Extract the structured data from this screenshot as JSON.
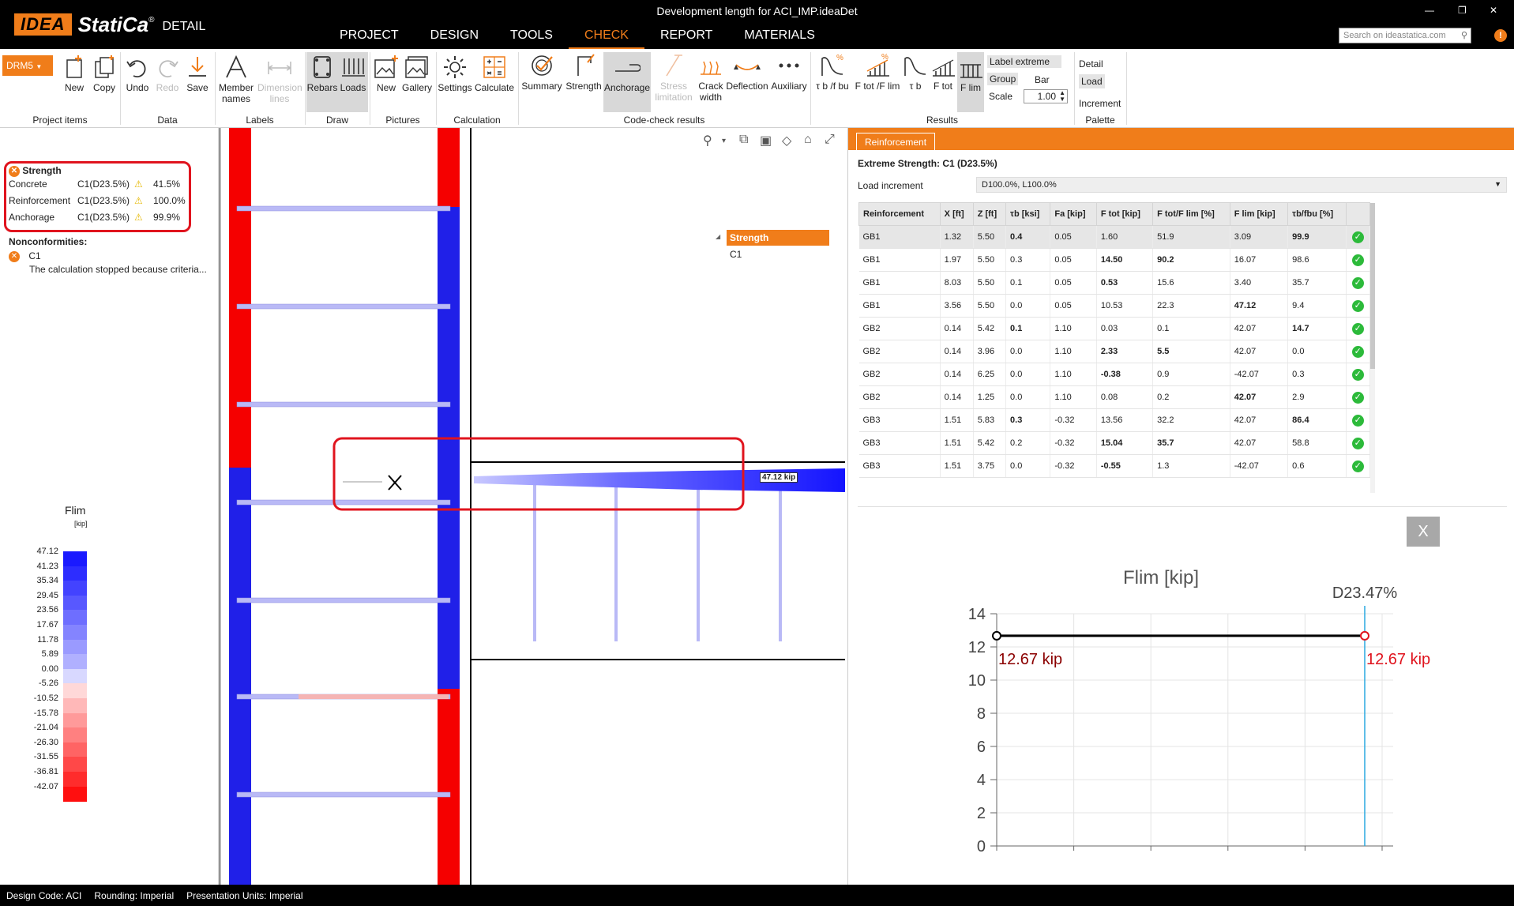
{
  "app": {
    "logo_box": "IDEA",
    "logo_name": "StatiCa",
    "logo_reg": "®",
    "product": "DETAIL",
    "window_title": "Development length for ACI_IMP.ideaDet",
    "minimize": "—",
    "maximize": "❐",
    "close": "✕"
  },
  "menu": {
    "tabs": [
      {
        "label": "PROJECT"
      },
      {
        "label": "DESIGN"
      },
      {
        "label": "TOOLS"
      },
      {
        "label": "CHECK"
      },
      {
        "label": "REPORT"
      },
      {
        "label": "MATERIALS"
      }
    ],
    "active": "CHECK",
    "search_placeholder": "Search on ideastatica.com"
  },
  "ribbon": {
    "model": "DRM5",
    "buttons": {
      "new": "New",
      "copy": "Copy",
      "undo": "Undo",
      "redo": "Redo",
      "save": "Save",
      "member_names_1": "Member",
      "member_names_2": "names",
      "dimension_lines_1": "Dimension",
      "dimension_lines_2": "lines",
      "rebars": "Rebars",
      "loads": "Loads",
      "new_picture": "New",
      "gallery": "Gallery",
      "settings": "Settings",
      "calculate": "Calculate",
      "summary": "Summary",
      "strength": "Strength",
      "anchorage": "Anchorage",
      "stress_limitation_1": "Stress",
      "stress_limitation_2": "limitation",
      "crack_width_1": "Crack",
      "crack_width_2": "width",
      "deflection": "Deflection",
      "auxiliary": "Auxiliary",
      "res_tb_fbu": "τ b /f bu",
      "res_ftot_flim": "F tot /F lim",
      "res_tb": "τ b",
      "res_ftot": "F tot",
      "res_flim": "F lim"
    },
    "groups": [
      "Project items",
      "Data",
      "Labels",
      "Draw",
      "Pictures",
      "Calculation",
      "Code-check results",
      "Results",
      "Palette"
    ],
    "options": {
      "label_extreme": "Label extreme",
      "group": "Group",
      "bar": "Bar",
      "scale_label": "Scale",
      "scale_value": "1.00",
      "detail": "Detail",
      "load": "Load",
      "increment": "Increment"
    }
  },
  "left": {
    "strength_title": "Strength",
    "checks": [
      {
        "name": "Concrete",
        "case": "C1(D23.5%)",
        "value": "41.5%"
      },
      {
        "name": "Reinforcement",
        "case": "C1(D23.5%)",
        "value": "100.0%"
      },
      {
        "name": "Anchorage",
        "case": "C1(D23.5%)",
        "value": "99.9%"
      }
    ],
    "nonconformities_title": "Nonconformities:",
    "nonconformity_item": "C1",
    "nonconformity_text": "The calculation stopped because criteria...",
    "legend_title": "Flim",
    "legend_unit": "[kip]",
    "legend_values": [
      "47.12",
      "41.23",
      "35.34",
      "29.45",
      "23.56",
      "17.67",
      "11.78",
      "5.89",
      "0.00",
      "-5.26",
      "-10.52",
      "-15.78",
      "-21.04",
      "-26.30",
      "-31.55",
      "-36.81",
      "-42.07"
    ],
    "legend_colors": [
      "#1a1aff",
      "#2d2dff",
      "#4343ff",
      "#5858ff",
      "#6e6eff",
      "#8484ff",
      "#9a9aff",
      "#b0b0ff",
      "#d8d8ff",
      "#ffd8d8",
      "#ffb8b8",
      "#ff9a9a",
      "#ff8080",
      "#ff6464",
      "#ff4848",
      "#ff2c2c",
      "#ff0f0f"
    ]
  },
  "viewport": {
    "tree_header": "Strength",
    "tree_item": "C1",
    "label_value": "47.12 kip",
    "colors": {
      "red": "#f50000",
      "blue": "#2020e8",
      "highlight": "#e0141e"
    }
  },
  "right": {
    "tab": "Reinforcement",
    "title": "Extreme Strength: C1 (D23.5%)",
    "load_increment_label": "Load increment",
    "load_increment_value": "D100.0%, L100.0%",
    "table": {
      "headers": [
        "Reinforcement",
        "X [ft]",
        "Z [ft]",
        "τb [ksi]",
        "Fa [kip]",
        "F tot [kip]",
        "F tot/F lim [%]",
        "F lim [kip]",
        "τb/fbu [%]",
        ""
      ],
      "rows": [
        {
          "c": [
            "GB1",
            "1.32",
            "5.50",
            "0.4",
            "0.05",
            "1.60",
            "51.9",
            "3.09",
            "99.9"
          ],
          "bold": [
            3,
            8
          ],
          "selected": true
        },
        {
          "c": [
            "GB1",
            "1.97",
            "5.50",
            "0.3",
            "0.05",
            "14.50",
            "90.2",
            "16.07",
            "98.6"
          ],
          "bold": [
            5,
            6
          ]
        },
        {
          "c": [
            "GB1",
            "8.03",
            "5.50",
            "0.1",
            "0.05",
            "0.53",
            "15.6",
            "3.40",
            "35.7"
          ],
          "bold": [
            5
          ]
        },
        {
          "c": [
            "GB1",
            "3.56",
            "5.50",
            "0.0",
            "0.05",
            "10.53",
            "22.3",
            "47.12",
            "9.4"
          ],
          "bold": [
            7
          ]
        },
        {
          "c": [
            "GB2",
            "0.14",
            "5.42",
            "0.1",
            "1.10",
            "0.03",
            "0.1",
            "42.07",
            "14.7"
          ],
          "bold": [
            3,
            8
          ]
        },
        {
          "c": [
            "GB2",
            "0.14",
            "3.96",
            "0.0",
            "1.10",
            "2.33",
            "5.5",
            "42.07",
            "0.0"
          ],
          "bold": [
            5,
            6
          ]
        },
        {
          "c": [
            "GB2",
            "0.14",
            "6.25",
            "0.0",
            "1.10",
            "-0.38",
            "0.9",
            "-42.07",
            "0.3"
          ],
          "bold": [
            5
          ]
        },
        {
          "c": [
            "GB2",
            "0.14",
            "1.25",
            "0.0",
            "1.10",
            "0.08",
            "0.2",
            "42.07",
            "2.9"
          ],
          "bold": [
            7
          ]
        },
        {
          "c": [
            "GB3",
            "1.51",
            "5.83",
            "0.3",
            "-0.32",
            "13.56",
            "32.2",
            "42.07",
            "86.4"
          ],
          "bold": [
            3,
            8
          ]
        },
        {
          "c": [
            "GB3",
            "1.51",
            "5.42",
            "0.2",
            "-0.32",
            "15.04",
            "35.7",
            "42.07",
            "58.8"
          ],
          "bold": [
            5,
            6
          ]
        },
        {
          "c": [
            "GB3",
            "1.51",
            "3.75",
            "0.0",
            "-0.32",
            "-0.55",
            "1.3",
            "-42.07",
            "0.6"
          ],
          "bold": [
            5
          ]
        }
      ]
    },
    "close_label": "X"
  },
  "chart_data": {
    "type": "line",
    "title": "Flim [kip]",
    "ylim": [
      0,
      14
    ],
    "yticks": [
      0,
      2,
      4,
      6,
      8,
      10,
      12,
      14
    ],
    "series": [
      {
        "values": [
          12.67,
          12.67
        ]
      }
    ],
    "labels": {
      "start": "12.67 kip",
      "end": "12.67 kip"
    },
    "marker_label": "D23.47%",
    "grid": true,
    "colors": {
      "line": "#000000",
      "end_point": "#e0141e",
      "start_label": "#8b0000",
      "end_label": "#e0141e",
      "marker_line": "#2aa9e0"
    }
  },
  "status": {
    "design_code": "Design Code: ACI",
    "rounding": "Rounding: Imperial",
    "units": "Presentation Units: Imperial"
  }
}
